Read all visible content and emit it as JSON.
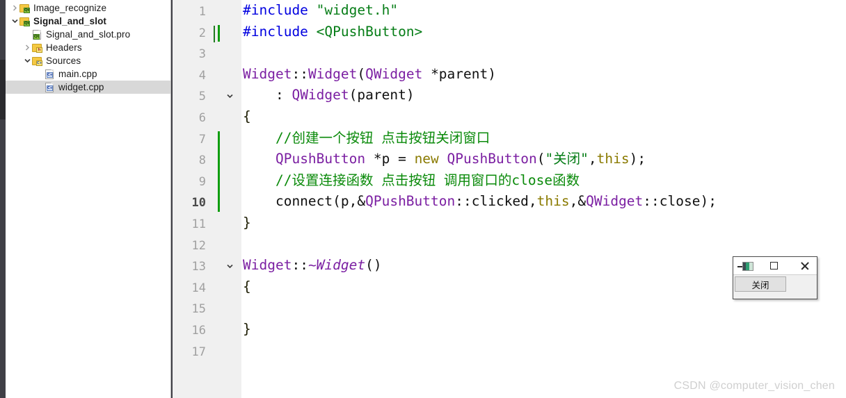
{
  "window": {
    "watermark": "CSDN @computer_vision_chen"
  },
  "sidebar": {
    "items": [
      {
        "label": "Image_recognize",
        "icon": "qt-folder-icon",
        "twisty": "chevron-right",
        "indent": 0,
        "bold": false,
        "selected": false
      },
      {
        "label": "Signal_and_slot",
        "icon": "qt-folder-icon",
        "twisty": "chevron-down",
        "indent": 0,
        "bold": true,
        "selected": false
      },
      {
        "label": "Signal_and_slot.pro",
        "icon": "qt-project-file-icon",
        "twisty": "none",
        "indent": 1,
        "bold": false,
        "selected": false
      },
      {
        "label": "Headers",
        "icon": "headers-folder-icon",
        "twisty": "chevron-right",
        "indent": 1,
        "bold": false,
        "selected": false
      },
      {
        "label": "Sources",
        "icon": "sources-folder-icon",
        "twisty": "chevron-down",
        "indent": 1,
        "bold": false,
        "selected": false
      },
      {
        "label": "main.cpp",
        "icon": "cpp-file-icon",
        "twisty": "none",
        "indent": 2,
        "bold": false,
        "selected": false
      },
      {
        "label": "widget.cpp",
        "icon": "cpp-file-icon",
        "twisty": "none",
        "indent": 2,
        "bold": false,
        "selected": true
      }
    ]
  },
  "editor": {
    "current_line": 10,
    "line_numbers": [
      "1",
      "2",
      "3",
      "4",
      "5",
      "6",
      "7",
      "8",
      "9",
      "10",
      "11",
      "12",
      "13",
      "14",
      "15",
      "16",
      "17"
    ],
    "fold_markers": {
      "5": "chevron-down",
      "13": "chevron-down"
    },
    "changed_lines": [
      2,
      7,
      8,
      9,
      10
    ],
    "lines": [
      {
        "n": "1",
        "tokens": [
          {
            "t": "#include ",
            "c": "kw"
          },
          {
            "t": "\"widget.h\"",
            "c": "str"
          }
        ]
      },
      {
        "n": "2",
        "tokens": [
          {
            "t": "#include ",
            "c": "kw"
          },
          {
            "t": "<QPushButton>",
            "c": "str"
          }
        ]
      },
      {
        "n": "3",
        "tokens": []
      },
      {
        "n": "4",
        "tokens": [
          {
            "t": "Widget",
            "c": "type"
          },
          {
            "t": "::",
            "c": "plain"
          },
          {
            "t": "Widget",
            "c": "type"
          },
          {
            "t": "(",
            "c": "plain"
          },
          {
            "t": "QWidget",
            "c": "type"
          },
          {
            "t": " *parent)",
            "c": "plain"
          }
        ]
      },
      {
        "n": "5",
        "tokens": [
          {
            "t": "    : ",
            "c": "plain"
          },
          {
            "t": "QWidget",
            "c": "type"
          },
          {
            "t": "(parent)",
            "c": "plain"
          }
        ]
      },
      {
        "n": "6",
        "tokens": [
          {
            "t": "{",
            "c": "brc"
          }
        ]
      },
      {
        "n": "7",
        "tokens": [
          {
            "t": "    ",
            "c": "plain"
          },
          {
            "t": "//创建一个按钮 点击按钮关闭窗口",
            "c": "cmt"
          }
        ]
      },
      {
        "n": "8",
        "tokens": [
          {
            "t": "    ",
            "c": "plain"
          },
          {
            "t": "QPushButton",
            "c": "type"
          },
          {
            "t": " *p = ",
            "c": "plain"
          },
          {
            "t": "new",
            "c": "kw2"
          },
          {
            "t": " ",
            "c": "plain"
          },
          {
            "t": "QPushButton",
            "c": "type"
          },
          {
            "t": "(",
            "c": "plain"
          },
          {
            "t": "\"关闭\"",
            "c": "str"
          },
          {
            "t": ",",
            "c": "plain"
          },
          {
            "t": "this",
            "c": "kw2"
          },
          {
            "t": ");",
            "c": "plain"
          }
        ]
      },
      {
        "n": "9",
        "tokens": [
          {
            "t": "    ",
            "c": "plain"
          },
          {
            "t": "//设置连接函数 点击按钮 调用窗口的close函数",
            "c": "cmt"
          }
        ]
      },
      {
        "n": "10",
        "tokens": [
          {
            "t": "    connect(p,&",
            "c": "plain"
          },
          {
            "t": "QPushButton",
            "c": "type"
          },
          {
            "t": "::clicked,",
            "c": "plain"
          },
          {
            "t": "this",
            "c": "kw2"
          },
          {
            "t": ",&",
            "c": "plain"
          },
          {
            "t": "QWidget",
            "c": "type"
          },
          {
            "t": "::close);",
            "c": "plain"
          }
        ]
      },
      {
        "n": "11",
        "tokens": [
          {
            "t": "}",
            "c": "brc"
          }
        ]
      },
      {
        "n": "12",
        "tokens": []
      },
      {
        "n": "13",
        "tokens": [
          {
            "t": "Widget",
            "c": "type"
          },
          {
            "t": "::",
            "c": "plain"
          },
          {
            "t": "~Widget",
            "c": "type it"
          },
          {
            "t": "()",
            "c": "plain"
          }
        ]
      },
      {
        "n": "14",
        "tokens": [
          {
            "t": "{",
            "c": "brc"
          }
        ]
      },
      {
        "n": "15",
        "tokens": []
      },
      {
        "n": "16",
        "tokens": [
          {
            "t": "}",
            "c": "brc"
          }
        ]
      },
      {
        "n": "17",
        "tokens": []
      }
    ]
  },
  "qt_window": {
    "title": "",
    "minimize_label": "minimize",
    "maximize_label": "maximize",
    "close_label": "close",
    "button_label": "关闭"
  },
  "colors": {
    "keyword": "#0000e0",
    "string": "#067d17",
    "type": "#7b1fa2",
    "keyword2": "#8a7a00",
    "comment": "#0a8a0a",
    "change_marker": "#0f9d0f",
    "selection": "#d8d8d8",
    "gutter_bg": "#f0f0f0"
  }
}
